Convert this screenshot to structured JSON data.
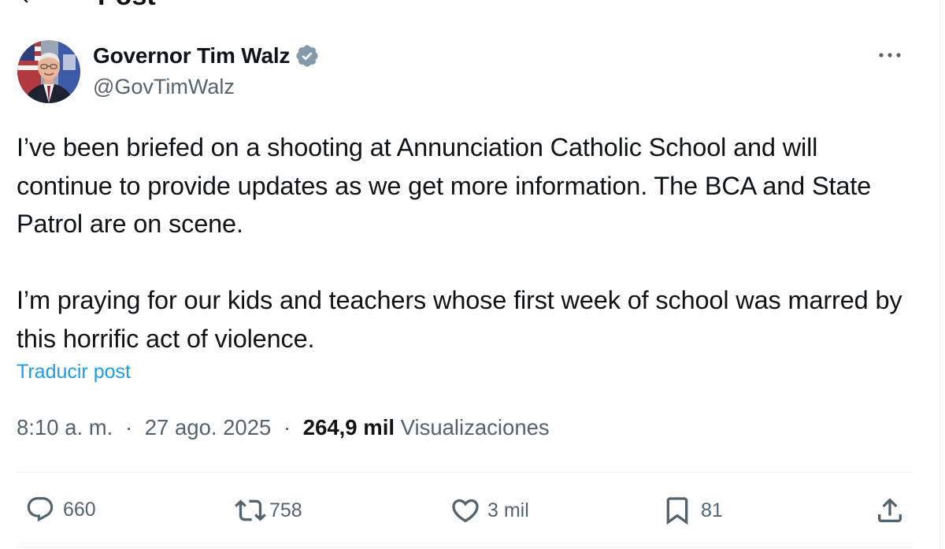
{
  "header": {
    "title": "Post"
  },
  "author": {
    "name": "Governor Tim Walz",
    "handle": "@GovTimWalz",
    "verified_color": "#829aab"
  },
  "post": {
    "paragraphs": [
      "I’ve been briefed on a shooting at Annunciation Catholic School and will continue to provide updates as we get more information. The BCA and State Patrol are on scene.",
      "I’m praying for our kids and teachers whose first week of school was marred by this horrific act of violence."
    ],
    "translate_label": "Traducir post"
  },
  "meta": {
    "time": "8:10 a. m.",
    "separator": "·",
    "date": "27 ago. 2025",
    "views_count": "264,9 mil",
    "views_label": "Visualizaciones"
  },
  "actions": {
    "replies": "660",
    "reposts": "758",
    "likes": "3 mil",
    "bookmarks": "81"
  },
  "colors": {
    "text_primary": "#0f1419",
    "text_secondary": "#536471",
    "link": "#1d9bf0",
    "divider": "#eff3f4"
  }
}
